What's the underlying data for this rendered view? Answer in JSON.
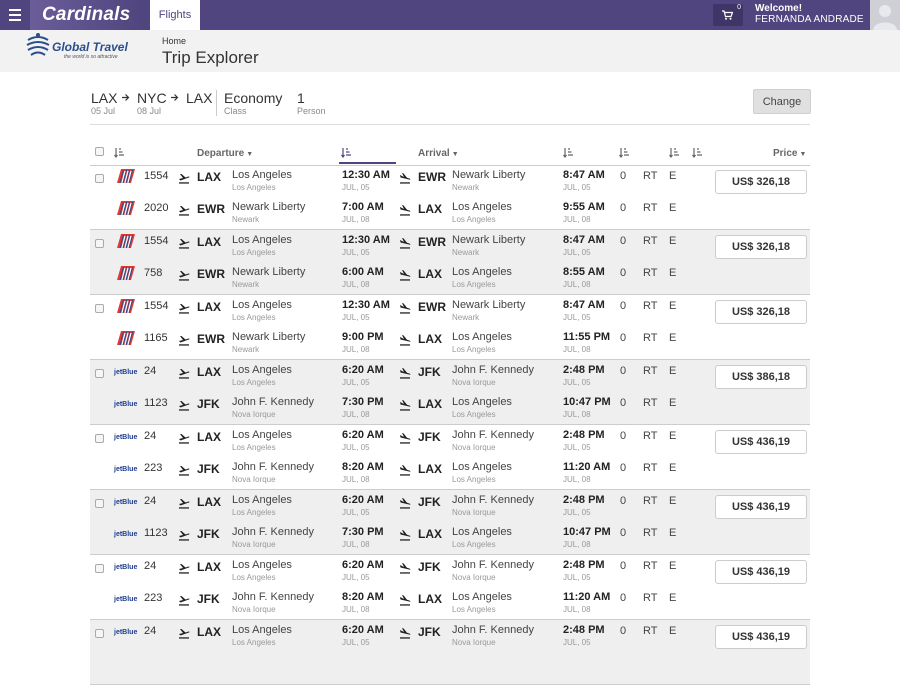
{
  "topbar": {
    "brand": "Cardinals",
    "tab": "Flights",
    "cart_count": "0",
    "welcome": "Welcome!",
    "user": "FERNANDA ANDRADE"
  },
  "logo": {
    "name": "Global Travel",
    "tagline": "the world is so attractive"
  },
  "header": {
    "breadcrumb": "Home",
    "title": "Trip Explorer"
  },
  "search": {
    "route": [
      {
        "code": "LAX",
        "date": "05 Jul"
      },
      {
        "code": "NYC",
        "date": "08 Jul"
      },
      {
        "code": "LAX",
        "date": ""
      }
    ],
    "class_value": "Economy",
    "class_label": "Class",
    "persons_value": "1",
    "persons_label": "Person",
    "change_label": "Change"
  },
  "columns": {
    "departure": "Departure",
    "arrival": "Arrival",
    "price": "Price"
  },
  "groups": [
    {
      "price": "US$ 326,18",
      "segments": [
        {
          "airline": "united",
          "flight": "1554",
          "dep_code": "LAX",
          "dep_city": "Los Angeles",
          "dep_sub": "Los Angeles",
          "dep_time": "12:30 AM",
          "dep_date": "JUL, 05",
          "arr_code": "EWR",
          "arr_city": "Newark Liberty",
          "arr_sub": "Newark",
          "arr_time": "8:47 AM",
          "arr_date": "JUL, 05",
          "stops": "0",
          "trip": "RT",
          "cls": "E"
        },
        {
          "airline": "united",
          "flight": "2020",
          "dep_code": "EWR",
          "dep_city": "Newark Liberty",
          "dep_sub": "Newark",
          "dep_time": "7:00 AM",
          "dep_date": "JUL, 08",
          "arr_code": "LAX",
          "arr_city": "Los Angeles",
          "arr_sub": "Los Angeles",
          "arr_time": "9:55 AM",
          "arr_date": "JUL, 08",
          "stops": "0",
          "trip": "RT",
          "cls": "E"
        }
      ]
    },
    {
      "price": "US$ 326,18",
      "segments": [
        {
          "airline": "united",
          "flight": "1554",
          "dep_code": "LAX",
          "dep_city": "Los Angeles",
          "dep_sub": "Los Angeles",
          "dep_time": "12:30 AM",
          "dep_date": "JUL, 05",
          "arr_code": "EWR",
          "arr_city": "Newark Liberty",
          "arr_sub": "Newark",
          "arr_time": "8:47 AM",
          "arr_date": "JUL, 05",
          "stops": "0",
          "trip": "RT",
          "cls": "E"
        },
        {
          "airline": "united",
          "flight": "758",
          "dep_code": "EWR",
          "dep_city": "Newark Liberty",
          "dep_sub": "Newark",
          "dep_time": "6:00 AM",
          "dep_date": "JUL, 08",
          "arr_code": "LAX",
          "arr_city": "Los Angeles",
          "arr_sub": "Los Angeles",
          "arr_time": "8:55 AM",
          "arr_date": "JUL, 08",
          "stops": "0",
          "trip": "RT",
          "cls": "E"
        }
      ]
    },
    {
      "price": "US$ 326,18",
      "segments": [
        {
          "airline": "united",
          "flight": "1554",
          "dep_code": "LAX",
          "dep_city": "Los Angeles",
          "dep_sub": "Los Angeles",
          "dep_time": "12:30 AM",
          "dep_date": "JUL, 05",
          "arr_code": "EWR",
          "arr_city": "Newark Liberty",
          "arr_sub": "Newark",
          "arr_time": "8:47 AM",
          "arr_date": "JUL, 05",
          "stops": "0",
          "trip": "RT",
          "cls": "E"
        },
        {
          "airline": "united",
          "flight": "1165",
          "dep_code": "EWR",
          "dep_city": "Newark Liberty",
          "dep_sub": "Newark",
          "dep_time": "9:00 PM",
          "dep_date": "JUL, 08",
          "arr_code": "LAX",
          "arr_city": "Los Angeles",
          "arr_sub": "Los Angeles",
          "arr_time": "11:55 PM",
          "arr_date": "JUL, 08",
          "stops": "0",
          "trip": "RT",
          "cls": "E"
        }
      ]
    },
    {
      "price": "US$ 386,18",
      "segments": [
        {
          "airline": "jetblue",
          "flight": "24",
          "dep_code": "LAX",
          "dep_city": "Los Angeles",
          "dep_sub": "Los Angeles",
          "dep_time": "6:20 AM",
          "dep_date": "JUL, 05",
          "arr_code": "JFK",
          "arr_city": "John F. Kennedy",
          "arr_sub": "Nova Iorque",
          "arr_time": "2:48 PM",
          "arr_date": "JUL, 05",
          "stops": "0",
          "trip": "RT",
          "cls": "E"
        },
        {
          "airline": "jetblue",
          "flight": "1123",
          "dep_code": "JFK",
          "dep_city": "John F. Kennedy",
          "dep_sub": "Nova Iorque",
          "dep_time": "7:30 PM",
          "dep_date": "JUL, 08",
          "arr_code": "LAX",
          "arr_city": "Los Angeles",
          "arr_sub": "Los Angeles",
          "arr_time": "10:47 PM",
          "arr_date": "JUL, 08",
          "stops": "0",
          "trip": "RT",
          "cls": "E"
        }
      ]
    },
    {
      "price": "US$ 436,19",
      "segments": [
        {
          "airline": "jetblue",
          "flight": "24",
          "dep_code": "LAX",
          "dep_city": "Los Angeles",
          "dep_sub": "Los Angeles",
          "dep_time": "6:20 AM",
          "dep_date": "JUL, 05",
          "arr_code": "JFK",
          "arr_city": "John F. Kennedy",
          "arr_sub": "Nova Iorque",
          "arr_time": "2:48 PM",
          "arr_date": "JUL, 05",
          "stops": "0",
          "trip": "RT",
          "cls": "E"
        },
        {
          "airline": "jetblue",
          "flight": "223",
          "dep_code": "JFK",
          "dep_city": "John F. Kennedy",
          "dep_sub": "Nova Iorque",
          "dep_time": "8:20 AM",
          "dep_date": "JUL, 08",
          "arr_code": "LAX",
          "arr_city": "Los Angeles",
          "arr_sub": "Los Angeles",
          "arr_time": "11:20 AM",
          "arr_date": "JUL, 08",
          "stops": "0",
          "trip": "RT",
          "cls": "E"
        }
      ]
    },
    {
      "price": "US$ 436,19",
      "segments": [
        {
          "airline": "jetblue",
          "flight": "24",
          "dep_code": "LAX",
          "dep_city": "Los Angeles",
          "dep_sub": "Los Angeles",
          "dep_time": "6:20 AM",
          "dep_date": "JUL, 05",
          "arr_code": "JFK",
          "arr_city": "John F. Kennedy",
          "arr_sub": "Nova Iorque",
          "arr_time": "2:48 PM",
          "arr_date": "JUL, 05",
          "stops": "0",
          "trip": "RT",
          "cls": "E"
        },
        {
          "airline": "jetblue",
          "flight": "1123",
          "dep_code": "JFK",
          "dep_city": "John F. Kennedy",
          "dep_sub": "Nova Iorque",
          "dep_time": "7:30 PM",
          "dep_date": "JUL, 08",
          "arr_code": "LAX",
          "arr_city": "Los Angeles",
          "arr_sub": "Los Angeles",
          "arr_time": "10:47 PM",
          "arr_date": "JUL, 08",
          "stops": "0",
          "trip": "RT",
          "cls": "E"
        }
      ]
    },
    {
      "price": "US$ 436,19",
      "segments": [
        {
          "airline": "jetblue",
          "flight": "24",
          "dep_code": "LAX",
          "dep_city": "Los Angeles",
          "dep_sub": "Los Angeles",
          "dep_time": "6:20 AM",
          "dep_date": "JUL, 05",
          "arr_code": "JFK",
          "arr_city": "John F. Kennedy",
          "arr_sub": "Nova Iorque",
          "arr_time": "2:48 PM",
          "arr_date": "JUL, 05",
          "stops": "0",
          "trip": "RT",
          "cls": "E"
        },
        {
          "airline": "jetblue",
          "flight": "223",
          "dep_code": "JFK",
          "dep_city": "John F. Kennedy",
          "dep_sub": "Nova Iorque",
          "dep_time": "8:20 AM",
          "dep_date": "JUL, 08",
          "arr_code": "LAX",
          "arr_city": "Los Angeles",
          "arr_sub": "Los Angeles",
          "arr_time": "11:20 AM",
          "arr_date": "JUL, 08",
          "stops": "0",
          "trip": "RT",
          "cls": "E"
        }
      ]
    },
    {
      "price": "US$ 436,19",
      "segments": [
        {
          "airline": "jetblue",
          "flight": "24",
          "dep_code": "LAX",
          "dep_city": "Los Angeles",
          "dep_sub": "Los Angeles",
          "dep_time": "6:20 AM",
          "dep_date": "JUL, 05",
          "arr_code": "JFK",
          "arr_city": "John F. Kennedy",
          "arr_sub": "Nova Iorque",
          "arr_time": "2:48 PM",
          "arr_date": "JUL, 05",
          "stops": "0",
          "trip": "RT",
          "cls": "E"
        }
      ]
    }
  ]
}
